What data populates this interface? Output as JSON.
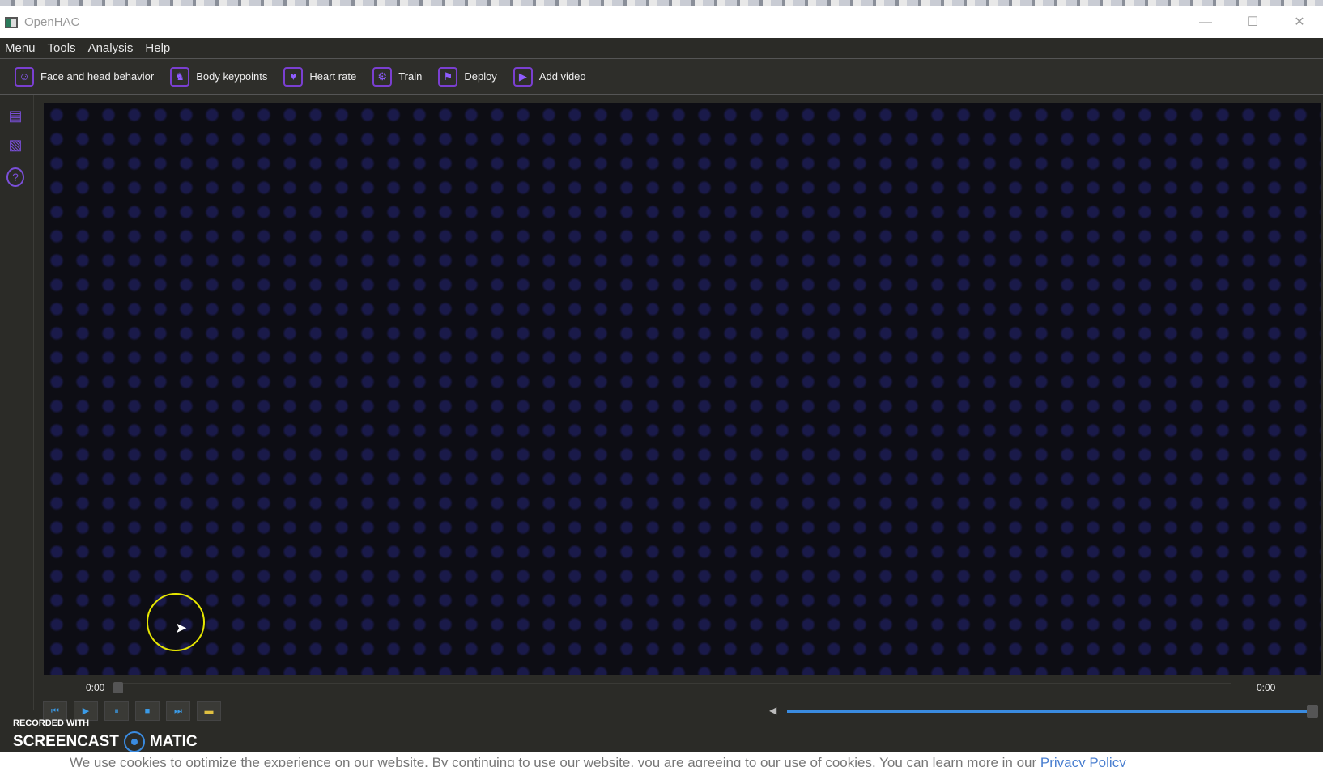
{
  "window": {
    "title": "OpenHAC",
    "minimize": "—",
    "maximize": "☐",
    "close": "✕"
  },
  "menu": [
    "Menu",
    "Tools",
    "Analysis",
    "Help"
  ],
  "toolbar": [
    {
      "label": "Face and head behavior",
      "icon": "☺"
    },
    {
      "label": "Body keypoints",
      "icon": "♞"
    },
    {
      "label": "Heart rate",
      "icon": "♥"
    },
    {
      "label": "Train",
      "icon": "⚙"
    },
    {
      "label": "Deploy",
      "icon": "⚑"
    },
    {
      "label": "Add video",
      "icon": "▶"
    }
  ],
  "sidebar": {
    "icons": [
      "▤",
      "▧",
      "?"
    ]
  },
  "player": {
    "current_time": "0:00",
    "total_time": "0:00",
    "progress": 0,
    "volume": 1.0,
    "buttons": [
      "⏮",
      "▶",
      "⏸",
      "■",
      "⏭",
      "▬"
    ]
  },
  "watermark": {
    "line1": "RECORDED WITH",
    "line2a": "SCREENCAST",
    "line2b": "MATIC"
  },
  "cookie": {
    "text": "We use cookies to optimize the experience on our website. By continuing to use our website, you are agreeing to our use of cookies. You can learn more in our ",
    "link": "Privacy Policy"
  }
}
